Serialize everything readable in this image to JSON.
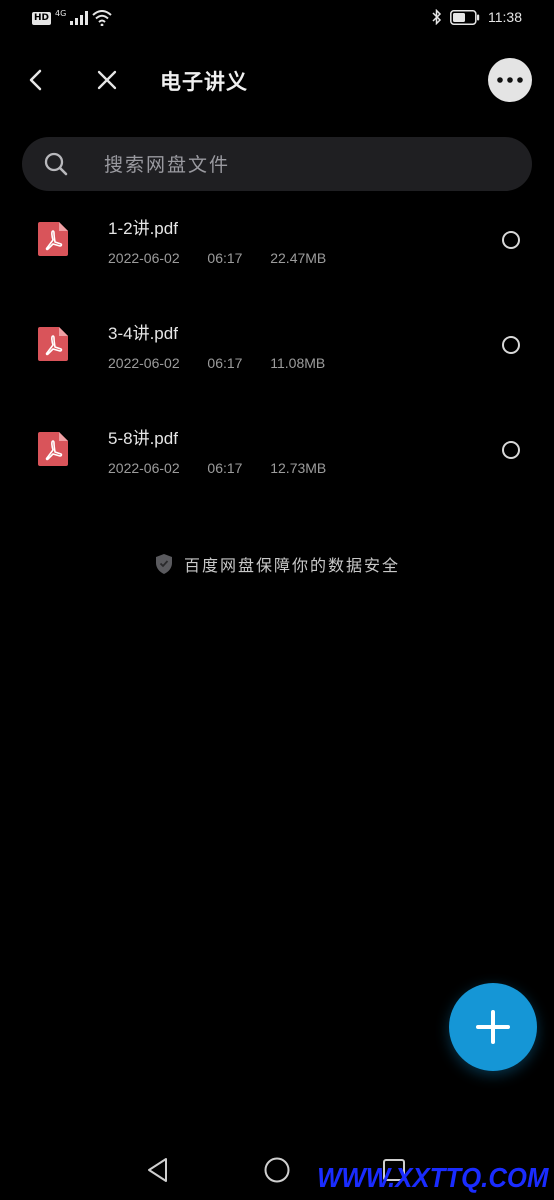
{
  "status_bar": {
    "hd_badge": "HD",
    "network": "4G",
    "time": "11:38"
  },
  "header": {
    "title": "电子讲义",
    "back_icon": "chevron-left-icon",
    "close_icon": "close-icon",
    "more_icon": "more-horizontal-icon"
  },
  "search": {
    "placeholder": "搜索网盘文件",
    "icon": "search-icon"
  },
  "files": [
    {
      "name": "1-2讲.pdf",
      "date": "2022-06-02",
      "time": "06:17",
      "size": "22.47MB",
      "type": "pdf"
    },
    {
      "name": "3-4讲.pdf",
      "date": "2022-06-02",
      "time": "06:17",
      "size": "11.08MB",
      "type": "pdf"
    },
    {
      "name": "5-8讲.pdf",
      "date": "2022-06-02",
      "time": "06:17",
      "size": "12.73MB",
      "type": "pdf"
    }
  ],
  "security_note": "百度网盘保障你的数据安全",
  "fab_icon": "plus-icon",
  "colors": {
    "fab": "#1596d6",
    "pdf_icon": "#d9545a",
    "background": "#000000"
  },
  "watermark": "WWW.XXTTQ.COM"
}
